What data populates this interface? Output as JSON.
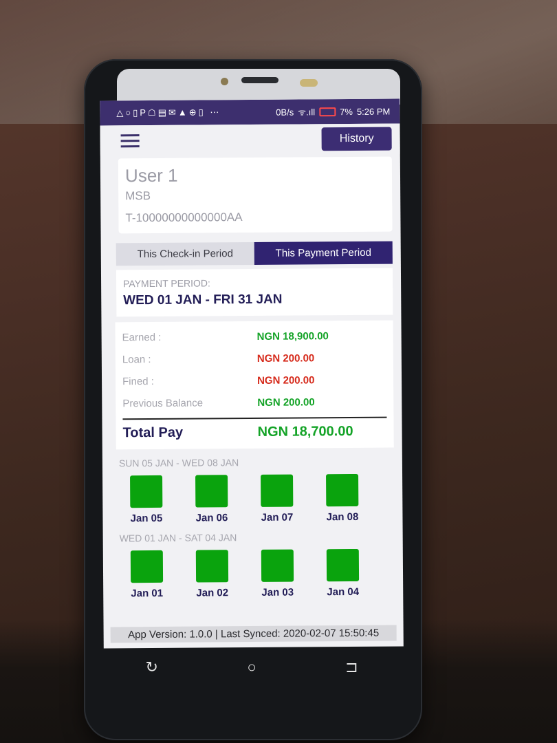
{
  "status_bar": {
    "left_icons": "△○▯P☖▤✉▲⊕▯ ⋯",
    "net_speed": "0B/s",
    "signal": "ᯤ.ıll",
    "battery": "7%",
    "time": "5:26 PM"
  },
  "header": {
    "history_label": "History"
  },
  "user": {
    "name": "User 1",
    "org": "MSB",
    "id": "T-10000000000000AA"
  },
  "tabs": [
    {
      "label": "This Check-in Period",
      "active": false
    },
    {
      "label": "This Payment Period",
      "active": true
    }
  ],
  "payment_period": {
    "label": "PAYMENT PERIOD:",
    "range": "WED 01 JAN - FRI 31 JAN"
  },
  "summary": {
    "rows": [
      {
        "label": "Earned :",
        "value": "NGN 18,900.00",
        "tone": "pos"
      },
      {
        "label": "Loan :",
        "value": "NGN 200.00",
        "tone": "neg"
      },
      {
        "label": "Fined :",
        "value": "NGN 200.00",
        "tone": "neg"
      },
      {
        "label": "Previous Balance",
        "value": "NGN 200.00",
        "tone": "pos"
      }
    ],
    "total_label": "Total Pay",
    "total_value": "NGN 18,700.00"
  },
  "weeks": [
    {
      "label": "SUN 05 JAN - WED 08 JAN",
      "days": [
        "Jan 05",
        "Jan 06",
        "Jan 07",
        "Jan 08"
      ]
    },
    {
      "label": "WED 01 JAN - SAT 04 JAN",
      "days": [
        "Jan 01",
        "Jan 02",
        "Jan 03",
        "Jan 04"
      ]
    }
  ],
  "footer": {
    "text": "App Version: 1.0.0 | Last Synced: 2020-02-07 15:50:45"
  },
  "nav_icons": {
    "recents": "recents-icon",
    "home": "home-icon",
    "back": "back-icon"
  },
  "colors": {
    "brand": "#302371",
    "positive": "#14a327",
    "negative": "#d62a1b",
    "day_present": "#0aa30d"
  }
}
